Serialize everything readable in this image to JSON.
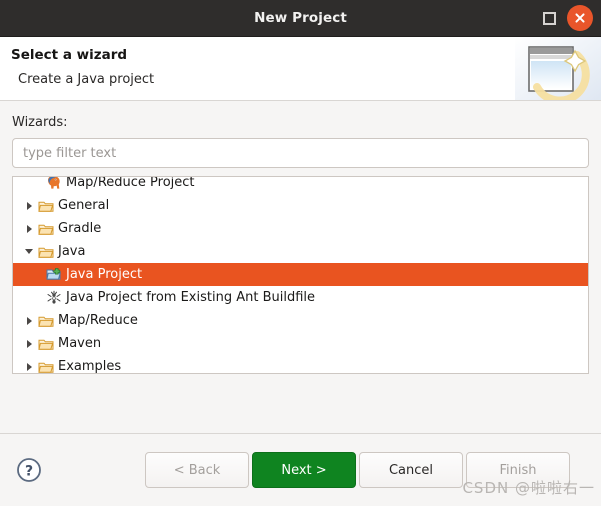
{
  "window": {
    "title": "New Project",
    "maximize_label": "Maximize",
    "close_label": "Close"
  },
  "header": {
    "title": "Select a wizard",
    "subtitle": "Create a Java project",
    "icon": "wizard-window-sparkle-icon"
  },
  "body": {
    "wizards_label": "Wizards:",
    "filter": {
      "placeholder": "type filter text",
      "value": ""
    },
    "tree": [
      {
        "label": "Map/Reduce Project",
        "icon": "hadoop-elephant-icon",
        "indent": 2,
        "twisty": "none",
        "selected": false
      },
      {
        "label": "General",
        "icon": "folder-icon",
        "indent": 1,
        "twisty": "collapsed",
        "selected": false
      },
      {
        "label": "Gradle",
        "icon": "folder-icon",
        "indent": 1,
        "twisty": "collapsed",
        "selected": false
      },
      {
        "label": "Java",
        "icon": "folder-icon",
        "indent": 1,
        "twisty": "expanded",
        "selected": false
      },
      {
        "label": "Java Project",
        "icon": "java-project-icon",
        "indent": 2,
        "twisty": "none",
        "selected": true
      },
      {
        "label": "Java Project from Existing Ant Buildfile",
        "icon": "ant-buildfile-icon",
        "indent": 2,
        "twisty": "none",
        "selected": false
      },
      {
        "label": "Map/Reduce",
        "icon": "folder-icon",
        "indent": 1,
        "twisty": "collapsed",
        "selected": false
      },
      {
        "label": "Maven",
        "icon": "folder-icon",
        "indent": 1,
        "twisty": "collapsed",
        "selected": false
      },
      {
        "label": "Examples",
        "icon": "folder-icon",
        "indent": 1,
        "twisty": "collapsed",
        "selected": false
      }
    ]
  },
  "footer": {
    "help_label": "?",
    "back_label": "< Back",
    "next_label": "Next >",
    "cancel_label": "Cancel",
    "finish_label": "Finish"
  },
  "watermark": "CSDN @啦啦右一",
  "colors": {
    "titlebar_bg": "#2f2d2c",
    "selection": "#e95420",
    "primary_button": "#0f8420",
    "close_button": "#e9552a",
    "dialog_bg": "#f6f5f4"
  }
}
